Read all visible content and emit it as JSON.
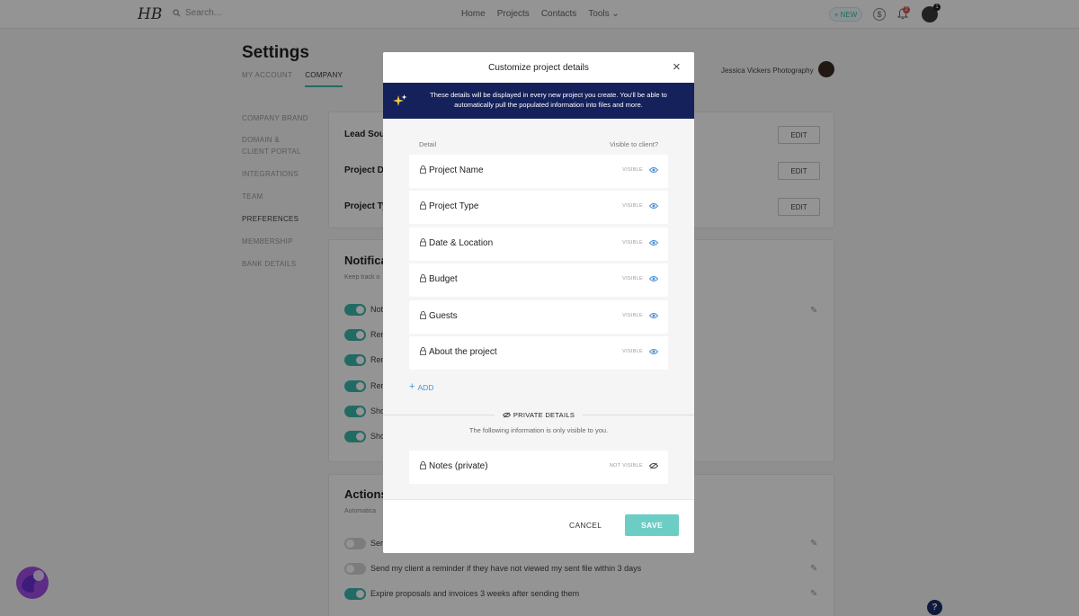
{
  "app": {
    "logo": "HB",
    "search_placeholder": "Search...",
    "nav": [
      "Home",
      "Projects",
      "Contacts",
      "Tools ⌄"
    ],
    "new_button": "+ NEW",
    "notification_count": "2",
    "user_badge": "1"
  },
  "settings": {
    "title": "Settings",
    "tabs": [
      "MY ACCOUNT",
      "COMPANY"
    ],
    "account_name": "Jessica Vickers Photography",
    "side_nav": [
      "COMPANY BRAND",
      "DOMAIN &",
      "CLIENT PORTAL",
      "INTEGRATIONS",
      "TEAM",
      "PREFERENCES",
      "MEMBERSHIP",
      "BANK DETAILS"
    ],
    "rows": [
      "Lead Sou",
      "Project D",
      "Project Ty"
    ],
    "edit_label": "EDIT",
    "notifications": {
      "title": "Notifica",
      "subtitle": "Keep track o",
      "toggles": [
        "Noti",
        "Ren",
        "Ren",
        "Ren",
        "Sho",
        "Sho"
      ]
    },
    "actions": {
      "title": "Actions",
      "subtitle": "Automatica",
      "items": [
        {
          "label": "Ser",
          "on": false
        },
        {
          "label": "Send my client a reminder if they have not viewed my sent file within 3 days",
          "on": false
        },
        {
          "label": "Expire proposals and invoices 3 weeks after sending them",
          "on": true
        }
      ]
    },
    "help": "?"
  },
  "modal": {
    "title": "Customize project details",
    "close": "×",
    "banner_text": "These details will be displayed in every new project you create. You'll be able to automatically pull the populated information into files and more.",
    "col_detail": "Detail",
    "col_visible": "Visible to client?",
    "details": [
      {
        "name": "Project Name",
        "visibility": "VISIBLE"
      },
      {
        "name": "Project Type",
        "visibility": "VISIBLE"
      },
      {
        "name": "Date & Location",
        "visibility": "VISIBLE"
      },
      {
        "name": "Budget",
        "visibility": "VISIBLE"
      },
      {
        "name": "Guests",
        "visibility": "VISIBLE"
      },
      {
        "name": "About the project",
        "visibility": "VISIBLE"
      }
    ],
    "add_label": "ADD",
    "private_title": "PRIVATE DETAILS",
    "private_subtitle": "The following information is only visible to you.",
    "private_details": [
      {
        "name": "Notes (private)",
        "visibility": "NOT VISIBLE"
      }
    ],
    "cancel_label": "CANCEL",
    "save_label": "SAVE"
  },
  "colors": {
    "accent": "#3cb8ac",
    "banner": "#14215b",
    "save_button": "#6ccdc5",
    "link": "#4a90d9"
  }
}
